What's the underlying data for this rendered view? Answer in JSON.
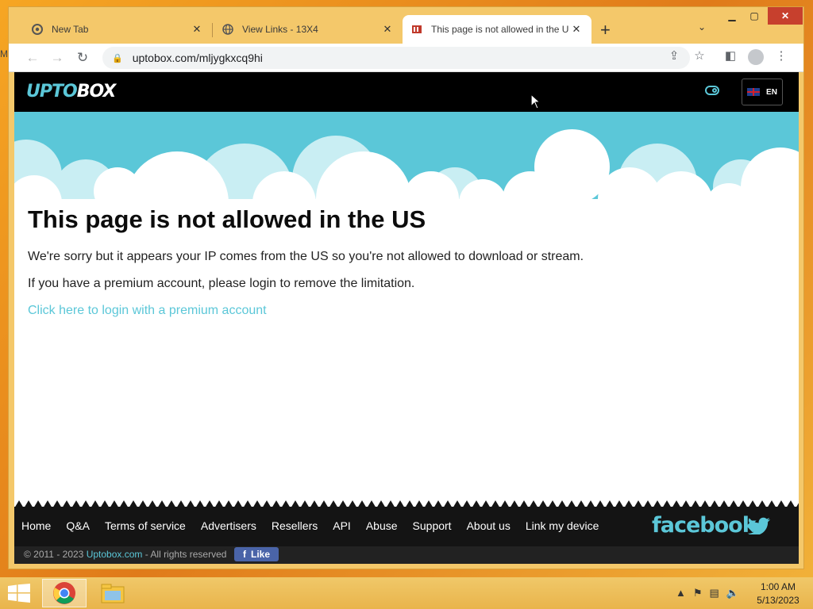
{
  "browser": {
    "tabs": [
      {
        "label": "New Tab",
        "icon": "chrome-icon"
      },
      {
        "label": "View Links - 13X4",
        "icon": "globe-icon"
      },
      {
        "label": "This page is not allowed in the U",
        "icon": "uptobox-favicon"
      }
    ],
    "url": "uptobox.com/mljygkxcq9hi"
  },
  "site": {
    "logo_part1": "UPTO",
    "logo_part2": "BOX",
    "lang": "EN"
  },
  "content": {
    "title": "This page is not allowed in the US",
    "paragraph1": "We're sorry but it appears your IP comes from the US so you're not allowed to download or stream.",
    "paragraph2": "If you have a premium account, please login to remove the limitation.",
    "login_link": "Click here to login with a premium account"
  },
  "footer": {
    "links": [
      "Home",
      "Q&A",
      "Terms of service",
      "Advertisers",
      "Resellers",
      "API",
      "Abuse",
      "Support",
      "About us",
      "Link my device"
    ],
    "copyright_prefix": "© 2011 - 2023 ",
    "copyright_site": "Uptobox.com",
    "copyright_suffix": " - All rights reserved",
    "like_label": "Like",
    "facebook_label": "facebook"
  },
  "taskbar": {
    "time": "1:00 AM",
    "date": "5/13/2023"
  },
  "colors": {
    "accent": "#5bc7d8",
    "header_bg": "#000000",
    "footer_bg": "#141414",
    "like_bg": "#4a64a8",
    "close_red": "#c7402d"
  }
}
